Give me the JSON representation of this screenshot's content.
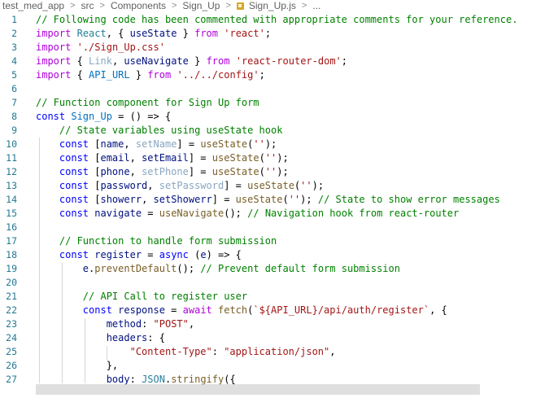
{
  "breadcrumb": {
    "items": [
      "test_med_app",
      "src",
      "Components",
      "Sign_Up",
      "Sign_Up.js",
      "..."
    ],
    "separator": ">"
  },
  "code_lines": [
    {
      "n": "1",
      "text": "// Following code has been commented with appropriate comments for your reference."
    },
    {
      "n": "2",
      "text": "import React, { useState } from 'react';"
    },
    {
      "n": "3",
      "text": "import './Sign_Up.css'"
    },
    {
      "n": "4",
      "text": "import { Link, useNavigate } from 'react-router-dom';"
    },
    {
      "n": "5",
      "text": "import { API_URL } from '../../config';"
    },
    {
      "n": "6",
      "text": ""
    },
    {
      "n": "7",
      "text": "// Function component for Sign Up form"
    },
    {
      "n": "8",
      "text": "const Sign_Up = () => {"
    },
    {
      "n": "9",
      "text": "    // State variables using useState hook"
    },
    {
      "n": "10",
      "text": "    const [name, setName] = useState('');"
    },
    {
      "n": "11",
      "text": "    const [email, setEmail] = useState('');"
    },
    {
      "n": "12",
      "text": "    const [phone, setPhone] = useState('');"
    },
    {
      "n": "13",
      "text": "    const [password, setPassword] = useState('');"
    },
    {
      "n": "14",
      "text": "    const [showerr, setShowerr] = useState(''); // State to show error messages"
    },
    {
      "n": "15",
      "text": "    const navigate = useNavigate(); // Navigation hook from react-router"
    },
    {
      "n": "16",
      "text": ""
    },
    {
      "n": "17",
      "text": "    // Function to handle form submission"
    },
    {
      "n": "18",
      "text": "    const register = async (e) => {"
    },
    {
      "n": "19",
      "text": "        e.preventDefault(); // Prevent default form submission"
    },
    {
      "n": "20",
      "text": ""
    },
    {
      "n": "21",
      "text": "        // API Call to register user"
    },
    {
      "n": "22",
      "text": "        const response = await fetch(`${API_URL}/api/auth/register`, {"
    },
    {
      "n": "23",
      "text": "            method: \"POST\","
    },
    {
      "n": "24",
      "text": "            headers: {"
    },
    {
      "n": "25",
      "text": "                \"Content-Type\": \"application/json\","
    },
    {
      "n": "26",
      "text": "            },"
    },
    {
      "n": "27",
      "text": "            body: JSON.stringify({"
    }
  ],
  "colors": {
    "keyword": "#0000ff",
    "control_keyword": "#af00db",
    "string": "#a31515",
    "comment": "#008000",
    "variable": "#001080",
    "function": "#795e26",
    "type": "#267f99",
    "constant": "#0070c1",
    "unused": "#8aa6c1",
    "line_number": "#237893",
    "file_icon": "#d8a629"
  },
  "icons": {
    "file_type": "javascript-file-icon"
  }
}
